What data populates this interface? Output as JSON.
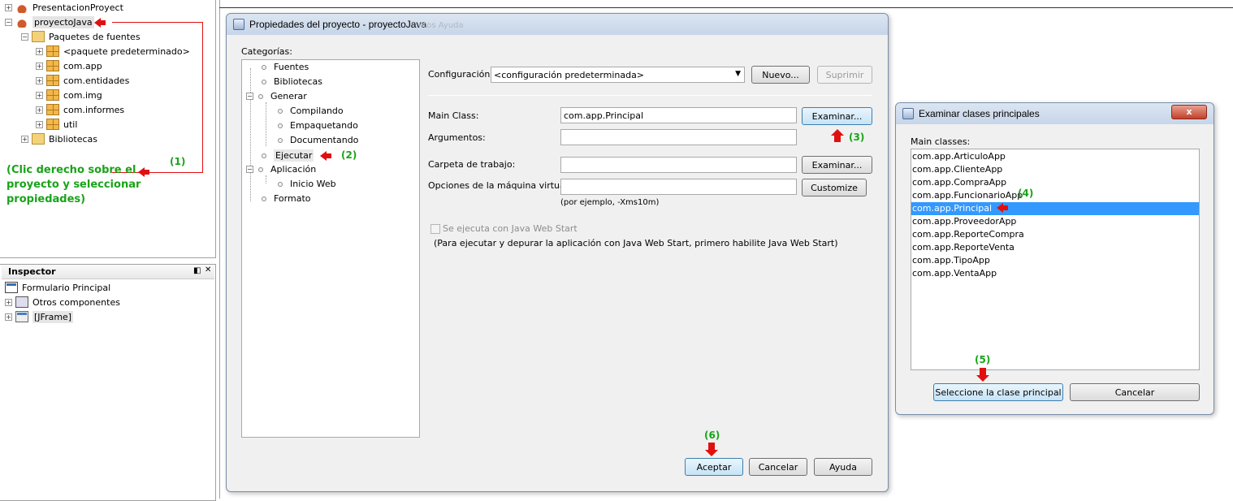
{
  "project_tree": {
    "items": [
      {
        "label": "PresentacionProyect"
      },
      {
        "label": "proyectoJava"
      },
      {
        "label": "Paquetes de fuentes"
      },
      {
        "label": "<paquete predeterminado>"
      },
      {
        "label": "com.app"
      },
      {
        "label": "com.entidades"
      },
      {
        "label": "com.img"
      },
      {
        "label": "com.informes"
      },
      {
        "label": "util"
      },
      {
        "label": "Bibliotecas"
      }
    ]
  },
  "annotations": {
    "step1": "(1)",
    "step1_text": "(Clic derecho sobre el proyecto y seleccionar propiedades)",
    "step2": "(2)",
    "step3": "(3)",
    "step4": "(4)",
    "step5": "(5)",
    "step6": "(6)"
  },
  "inspector": {
    "title": "Inspector",
    "items": [
      {
        "label": "Formulario Principal"
      },
      {
        "label": "Otros componentes"
      },
      {
        "label": "[JFrame]"
      }
    ]
  },
  "props_dialog": {
    "title": "Propiedades del proyecto - proyectoJava",
    "ghost_title": "ntos Ayuda",
    "categories_label": "Categorías:",
    "categories": [
      {
        "label": "Fuentes"
      },
      {
        "label": "Bibliotecas"
      },
      {
        "label": "Generar"
      },
      {
        "label": "Compilando"
      },
      {
        "label": "Empaquetando"
      },
      {
        "label": "Documentando"
      },
      {
        "label": "Ejecutar"
      },
      {
        "label": "Aplicación"
      },
      {
        "label": "Inicio Web"
      },
      {
        "label": "Formato"
      }
    ],
    "config_label": "Configuración:",
    "config_value": "<configuración predeterminada>",
    "nuevo_button": "Nuevo...",
    "suprimir_button": "Suprimir",
    "main_class_label": "Main Class:",
    "main_class_value": "com.app.Principal",
    "examinar_button": "Examinar...",
    "argumentos_label": "Argumentos:",
    "argumentos_value": "",
    "carpeta_label": "Carpeta de trabajo:",
    "carpeta_value": "",
    "examinar2_button": "Examinar...",
    "vm_label": "Opciones de la máquina virtual:",
    "vm_value": "",
    "customize_button": "Customize",
    "vm_hint": "(por ejemplo, -Xms10m)",
    "webstart_label": "Se ejecuta con Java Web Start",
    "webstart_checked": false,
    "webstart_hint": "(Para ejecutar y depurar la aplicación con Java Web Start, primero habilite Java Web Start)",
    "aceptar_button": "Aceptar",
    "cancelar_button": "Cancelar",
    "ayuda_button": "Ayuda"
  },
  "examinar_dialog": {
    "title": "Examinar clases principales",
    "close_label": "x",
    "main_classes_label": "Main classes:",
    "classes": [
      {
        "label": "com.app.ArticuloApp"
      },
      {
        "label": "com.app.ClienteApp"
      },
      {
        "label": "com.app.CompraApp"
      },
      {
        "label": "com.app.FuncionarioApp"
      },
      {
        "label": "com.app.Principal"
      },
      {
        "label": "com.app.ProveedorApp"
      },
      {
        "label": "com.app.ReporteCompra"
      },
      {
        "label": "com.app.ReporteVenta"
      },
      {
        "label": "com.app.TipoApp"
      },
      {
        "label": "com.app.VentaApp"
      }
    ],
    "selected_class": "com.app.Principal",
    "select_button": "Seleccione la clase principal",
    "cancel_button": "Cancelar"
  },
  "colors": {
    "annotation_green": "#19a319",
    "arrow_red": "#e01010",
    "selection_blue": "#3399ff"
  }
}
